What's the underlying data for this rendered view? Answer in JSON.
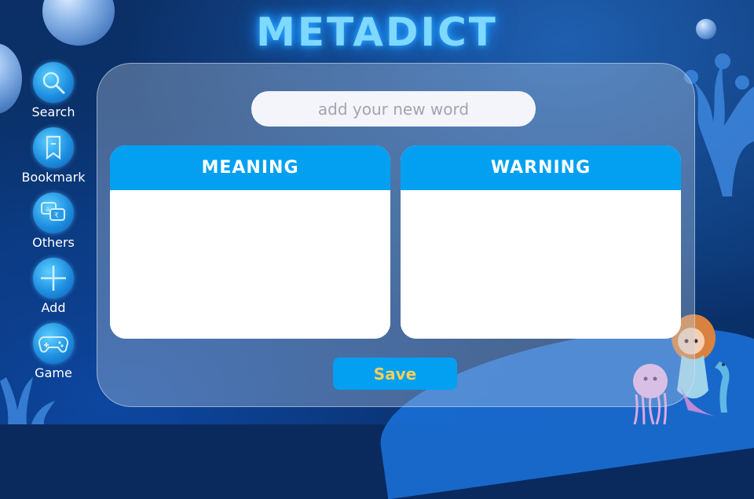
{
  "app": {
    "title": "METADICT"
  },
  "nav": [
    {
      "label": "Search",
      "icon": "search-icon"
    },
    {
      "label": "Bookmark",
      "icon": "bookmark-icon"
    },
    {
      "label": "Others",
      "icon": "translate-icon"
    },
    {
      "label": "Add",
      "icon": "plus-icon"
    },
    {
      "label": "Game",
      "icon": "gamepad-icon"
    }
  ],
  "form": {
    "word_placeholder": "add your new word",
    "word_value": "",
    "meaning_header": "MEANING",
    "meaning_value": "",
    "warning_header": "WARNING",
    "warning_value": "",
    "save_label": "Save"
  },
  "colors": {
    "accent": "#03A0F2",
    "save_text": "#F7CF5A",
    "title_glow": "#7FD8FF",
    "background": "#0A2A5E"
  }
}
